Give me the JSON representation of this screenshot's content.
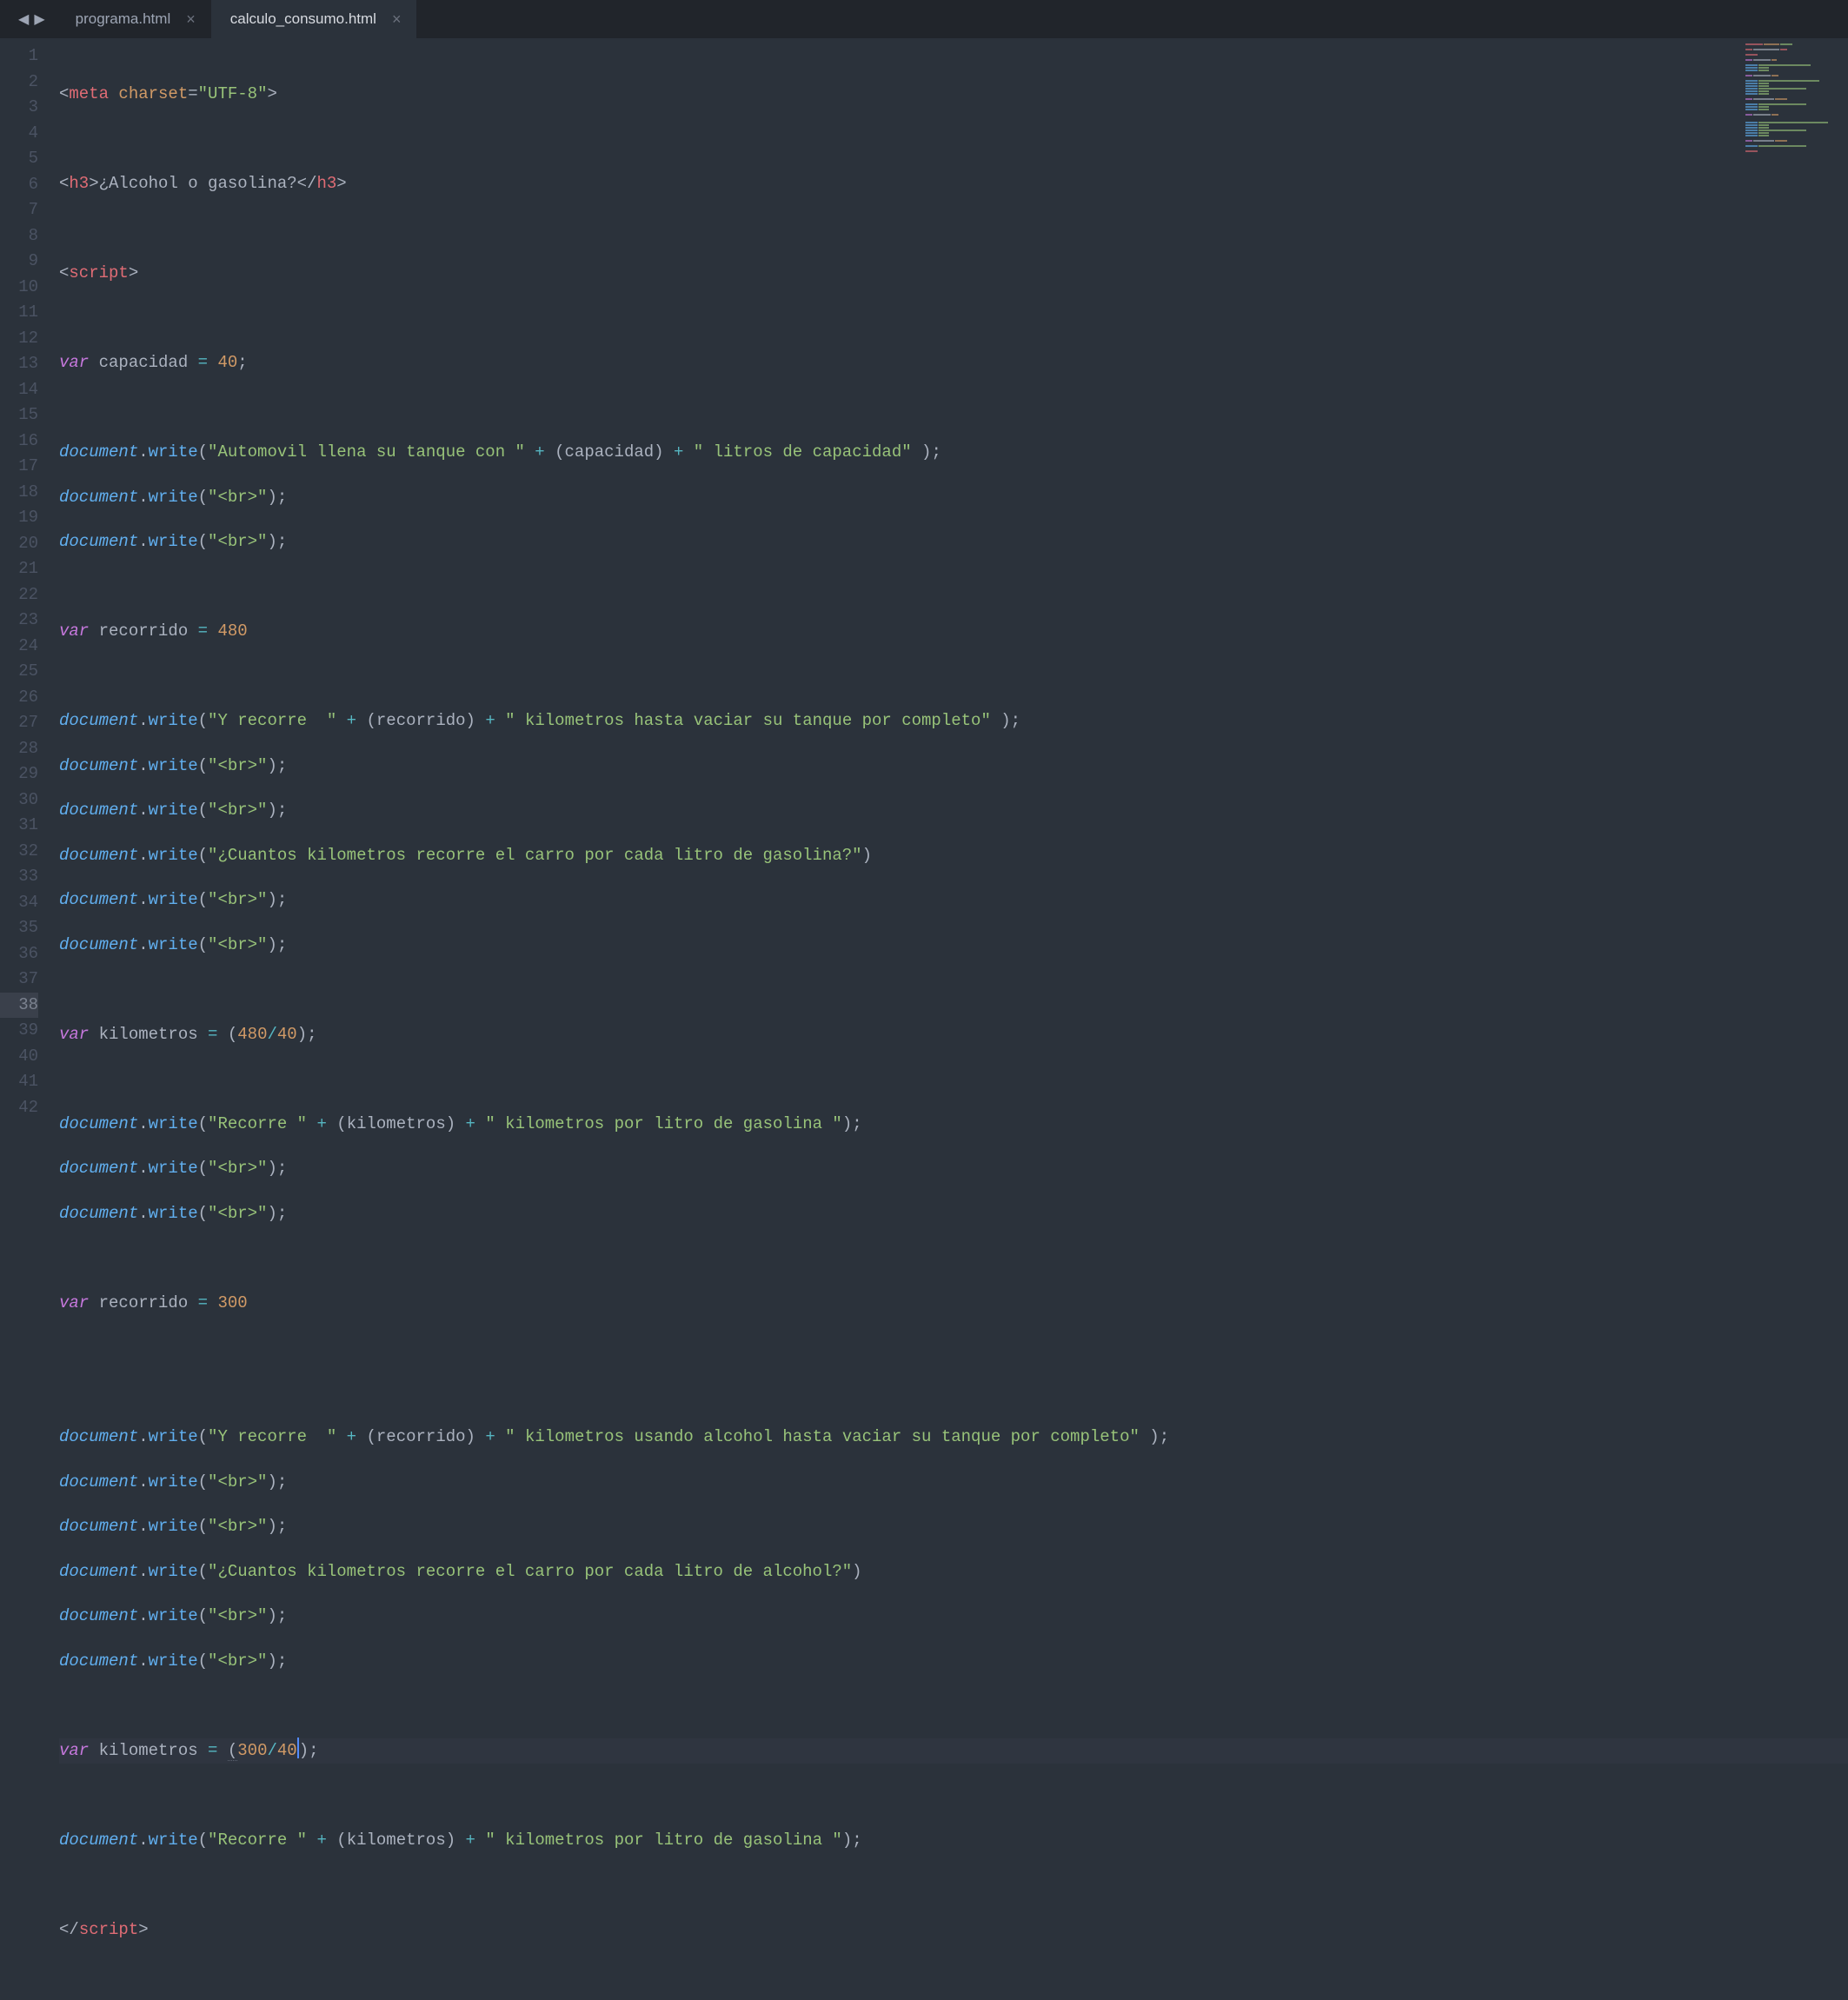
{
  "tabs": {
    "inactive": {
      "label": "programa.html"
    },
    "active": {
      "label": "calculo_consumo.html"
    }
  },
  "nav": {
    "back": "◀",
    "forward": "▶"
  },
  "gutter": {
    "start": 1,
    "end": 42,
    "active": 38
  },
  "code": {
    "l1": {
      "open": "<",
      "tag": "meta",
      "sp": " ",
      "attr": "charset",
      "eq": "=",
      "val": "\"UTF-8\"",
      "close": ">"
    },
    "l3": {
      "o1": "<",
      "t1": "h3",
      "c1": ">",
      "txt": "¿Alcohol o gasolina?",
      "o2": "</",
      "t2": "h3",
      "c2": ">"
    },
    "l5": {
      "o": "<",
      "t": "script",
      "c": ">"
    },
    "l7": {
      "kw": "var",
      "name": " capacidad ",
      "op": "=",
      "sp": " ",
      "num": "40",
      "semi": ";"
    },
    "l9": {
      "obj": "document",
      "dot": ".",
      "fn": "write",
      "lp": "(",
      "s1": "\"Automovil llena su tanque con \"",
      "op1": " + ",
      "lp2": "(",
      "v": "capacidad",
      "rp2": ")",
      "op2": " + ",
      "s2": "\" litros de capacidad\"",
      "sp": " ",
      "rp": ")",
      "semi": ";"
    },
    "l10": {
      "obj": "document",
      "dot": ".",
      "fn": "write",
      "lp": "(",
      "s": "\"<br>\"",
      "rp": ")",
      "semi": ";"
    },
    "l11": {
      "obj": "document",
      "dot": ".",
      "fn": "write",
      "lp": "(",
      "s": "\"<br>\"",
      "rp": ")",
      "semi": ";"
    },
    "l13": {
      "kw": "var",
      "name": " recorrido ",
      "op": "=",
      "sp": " ",
      "num": "480"
    },
    "l15": {
      "obj": "document",
      "dot": ".",
      "fn": "write",
      "lp": "(",
      "s1": "\"Y recorre  \"",
      "op1": " + ",
      "lp2": "(",
      "v": "recorrido",
      "rp2": ")",
      "op2": " + ",
      "s2": "\" kilometros hasta vaciar su tanque por completo\"",
      "sp": " ",
      "rp": ")",
      "semi": ";"
    },
    "l16": {
      "obj": "document",
      "dot": ".",
      "fn": "write",
      "lp": "(",
      "s": "\"<br>\"",
      "rp": ")",
      "semi": ";"
    },
    "l17": {
      "obj": "document",
      "dot": ".",
      "fn": "write",
      "lp": "(",
      "s": "\"<br>\"",
      "rp": ")",
      "semi": ";"
    },
    "l18": {
      "obj": "document",
      "dot": ".",
      "fn": "write",
      "lp": "(",
      "s": "\"¿Cuantos kilometros recorre el carro por cada litro de gasolina?\"",
      "rp": ")"
    },
    "l19": {
      "obj": "document",
      "dot": ".",
      "fn": "write",
      "lp": "(",
      "s": "\"<br>\"",
      "rp": ")",
      "semi": ";"
    },
    "l20": {
      "obj": "document",
      "dot": ".",
      "fn": "write",
      "lp": "(",
      "s": "\"<br>\"",
      "rp": ")",
      "semi": ";"
    },
    "l22": {
      "kw": "var",
      "name": " kilometros ",
      "op": "=",
      "sp": " ",
      "lp": "(",
      "n1": "480",
      "div": "/",
      "n2": "40",
      "rp": ")",
      "semi": ";"
    },
    "l24": {
      "obj": "document",
      "dot": ".",
      "fn": "write",
      "lp": "(",
      "s1": "\"Recorre \"",
      "op1": " + ",
      "lp2": "(",
      "v": "kilometros",
      "rp2": ")",
      "op2": " + ",
      "s2": "\" kilometros por litro de gasolina \"",
      "rp": ")",
      "semi": ";"
    },
    "l25": {
      "obj": "document",
      "dot": ".",
      "fn": "write",
      "lp": "(",
      "s": "\"<br>\"",
      "rp": ")",
      "semi": ";"
    },
    "l26": {
      "obj": "document",
      "dot": ".",
      "fn": "write",
      "lp": "(",
      "s": "\"<br>\"",
      "rp": ")",
      "semi": ";"
    },
    "l28": {
      "kw": "var",
      "name": " recorrido ",
      "op": "=",
      "sp": " ",
      "num": "300"
    },
    "l31": {
      "obj": "document",
      "dot": ".",
      "fn": "write",
      "lp": "(",
      "s1": "\"Y recorre  \"",
      "op1": " + ",
      "lp2": "(",
      "v": "recorrido",
      "rp2": ")",
      "op2": " + ",
      "s2": "\" kilometros usando alcohol hasta vaciar su tanque por completo\"",
      "sp": " ",
      "rp": ")",
      "semi": ";"
    },
    "l32": {
      "obj": "document",
      "dot": ".",
      "fn": "write",
      "lp": "(",
      "s": "\"<br>\"",
      "rp": ")",
      "semi": ";"
    },
    "l33": {
      "obj": "document",
      "dot": ".",
      "fn": "write",
      "lp": "(",
      "s": "\"<br>\"",
      "rp": ")",
      "semi": ";"
    },
    "l34": {
      "obj": "document",
      "dot": ".",
      "fn": "write",
      "lp": "(",
      "s": "\"¿Cuantos kilometros recorre el carro por cada litro de alcohol?\"",
      "rp": ")"
    },
    "l35": {
      "obj": "document",
      "dot": ".",
      "fn": "write",
      "lp": "(",
      "s": "\"<br>\"",
      "rp": ")",
      "semi": ";"
    },
    "l36": {
      "obj": "document",
      "dot": ".",
      "fn": "write",
      "lp": "(",
      "s": "\"<br>\"",
      "rp": ")",
      "semi": ";"
    },
    "l38": {
      "kw": "var",
      "name": " kilometros ",
      "op": "=",
      "sp": " ",
      "lp": "(",
      "n1": "300",
      "div": "/",
      "n2": "40",
      "rp": ")",
      "semi": ";"
    },
    "l40": {
      "obj": "document",
      "dot": ".",
      "fn": "write",
      "lp": "(",
      "s1": "\"Recorre \"",
      "op1": " + ",
      "lp2": "(",
      "v": "kilometros",
      "rp2": ")",
      "op2": " + ",
      "s2": "\" kilometros por litro de gasolina \"",
      "rp": ")",
      "semi": ";"
    },
    "l42": {
      "o": "</",
      "t": "script",
      "c": ">"
    }
  }
}
